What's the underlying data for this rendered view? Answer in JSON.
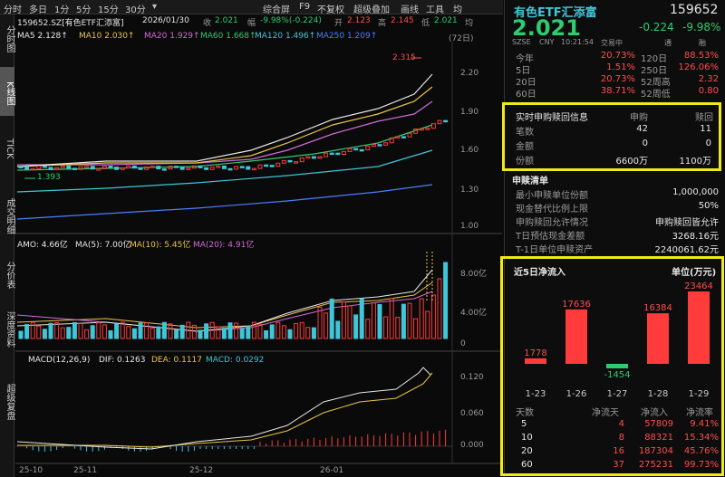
{
  "toolbar": {
    "tab1": "分时",
    "tab2": "多日",
    "tab3": "1分",
    "tab4": "5分",
    "tab5": "15分",
    "tab6": "30分",
    "drop": "▾",
    "b1": "综合屏",
    "b2": "F9",
    "b3": "不复权",
    "b4": "超级叠加",
    "b5": "画线",
    "b6": "工具",
    "b7": "均"
  },
  "leftnav": {
    "a": "分时图",
    "b": "K线图",
    "c": "TICK",
    "d": "成交明细",
    "e": "分价表",
    "f": "深度资料",
    "g": "超级复盘"
  },
  "info": {
    "code": "159652.SZ[有色ETF汇添富]",
    "date": "2026/01/30",
    "close_lbl": "收",
    "close": "2.021",
    "amp_lbl": "幅",
    "amp": "-9.98%(-0.224)",
    "open_lbl": "开",
    "open": "2.123",
    "high_lbl": "高",
    "high": "2.145",
    "low_lbl": "低",
    "low": "2.021",
    "tail": "均"
  },
  "ma": {
    "ma5": "MA5 2.128↑",
    "ma10": "MA10 2.030↑",
    "ma20": "MA20 1.929↑",
    "ma60": "MA60 1.668↑",
    "ma120": "MA120 1.496↑",
    "ma250": "MA250 1.209↑",
    "period": "(72日)"
  },
  "kchart": {
    "hi": "2.315",
    "lo": "1.393",
    "y1": "2.20",
    "y2": "1.90",
    "y3": "1.60",
    "y4": "1.30",
    "y5": "1.00"
  },
  "vol": {
    "amo": "AMO: 4.66亿",
    "ma5": "MA(5): 7.00亿",
    "ma10": "MA(10): 5.45亿",
    "ma20": "MA(20): 4.91亿",
    "y1": "8.00亿",
    "y2": "4.00亿",
    "y3": "0"
  },
  "macd": {
    "label": "MACD(12,26,9)",
    "dif": "DIF: 0.1263",
    "dea": "DEA: 0.1117",
    "macd": "MACD: 0.0292",
    "y1": "0.120",
    "y2": "0.060",
    "y3": "0.000"
  },
  "dates": [
    "25-10",
    "25-11",
    "25-12",
    "26-01"
  ],
  "quote": {
    "name": "有色ETF汇添富",
    "code": "159652",
    "price": "2.021",
    "chg": "-0.224",
    "pct": "-9.98%",
    "mkt": "SZSE",
    "cur": "CNY",
    "time": "10:21:54",
    "status": "交易中",
    "tong": "通",
    "rong": "融",
    "stats": [
      {
        "k1": "今年",
        "v1": "20.73%",
        "k2": "120日",
        "v2": "88.53%"
      },
      {
        "k1": "5日",
        "v1": "1.51%",
        "k2": "250日",
        "v2": "126.06%"
      },
      {
        "k1": "20日",
        "v1": "20.73%",
        "k2": "52周高",
        "v2": "2.32"
      },
      {
        "k1": "60日",
        "v1": "38.71%",
        "k2": "52周低",
        "v2": "0.80"
      }
    ]
  },
  "realtime": {
    "title": "实时申购赎回信息",
    "c1": "申购",
    "c2": "赎回",
    "rows": [
      {
        "k": "笔数",
        "a": "42",
        "b": "11"
      },
      {
        "k": "金额",
        "a": "0",
        "b": "0"
      },
      {
        "k": "份额",
        "a": "6600万",
        "b": "1100万"
      }
    ]
  },
  "redeem": {
    "title": "申赎清单",
    "rows": [
      {
        "k": "最小申赎单位份额",
        "v": "1,000,000"
      },
      {
        "k": "现金替代比例上限",
        "v": "50%"
      },
      {
        "k": "申购赎回允许情况",
        "v": "申购赎回皆允许"
      },
      {
        "k": "T日预估现金差额",
        "v": "3268.16元"
      },
      {
        "k": "T-1日单位申赎资产",
        "v": "2240061.62元"
      }
    ]
  },
  "flow": {
    "title": "近5日净流入",
    "unit": "单位(万元)",
    "bars": [
      {
        "d": "1-23",
        "v": 1778
      },
      {
        "d": "1-26",
        "v": 17636
      },
      {
        "d": "1-27",
        "v": -1454
      },
      {
        "d": "1-28",
        "v": 16384
      },
      {
        "d": "1-29",
        "v": 23464
      }
    ],
    "th": {
      "a": "天数",
      "b": "净流天",
      "c": "净流入",
      "d": "净流率"
    },
    "rows": [
      {
        "a": "5",
        "b": "4",
        "c": "57809",
        "d": "9.41%"
      },
      {
        "a": "10",
        "b": "8",
        "c": "88321",
        "d": "15.34%"
      },
      {
        "a": "20",
        "b": "16",
        "c": "187304",
        "d": "45.76%"
      },
      {
        "a": "60",
        "b": "37",
        "c": "275231",
        "d": "99.73%"
      }
    ]
  },
  "colors": {
    "up": "#ff3b3b",
    "down": "#2ecc71",
    "cyan": "#3fc6d8",
    "highlight": "#f0ea18"
  }
}
